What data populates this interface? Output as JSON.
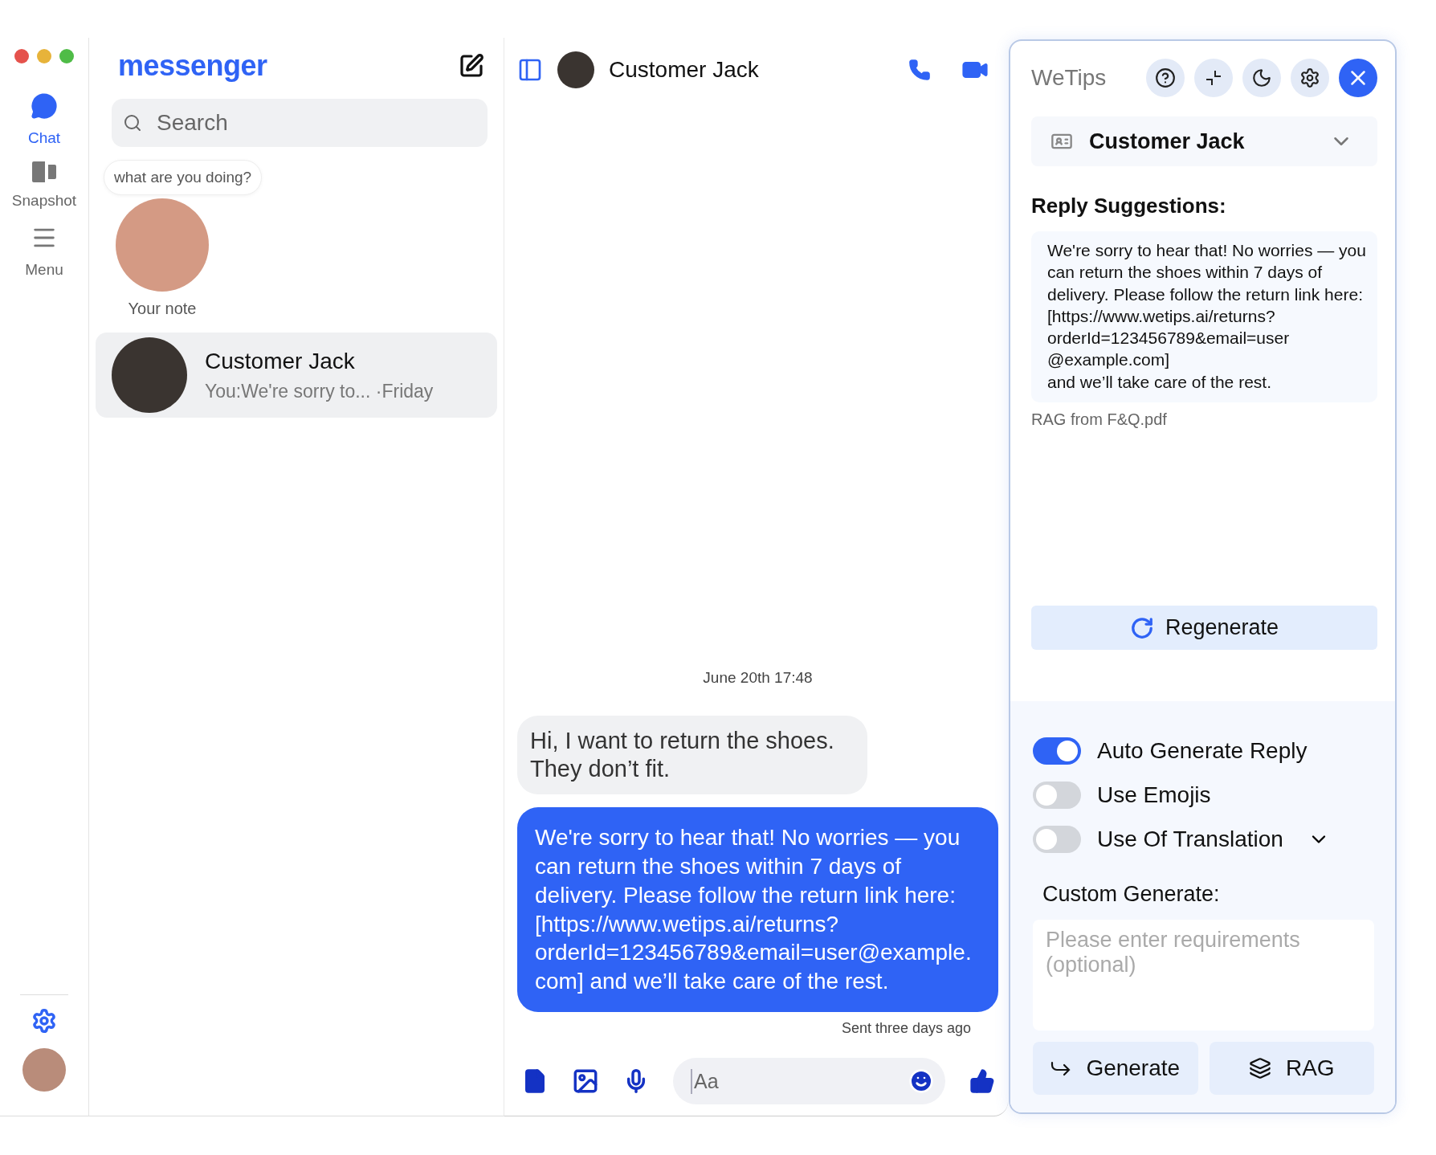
{
  "rail": {
    "items": [
      {
        "kind": "chat",
        "label": "Chat",
        "selected": true
      },
      {
        "kind": "snapshot",
        "label": "Snapshot",
        "selected": false
      },
      {
        "kind": "menu",
        "label": "Menu",
        "selected": false
      }
    ]
  },
  "sidebar": {
    "title": "messenger",
    "search": {
      "placeholder": "Search"
    },
    "note": {
      "text": "what are you doing?",
      "label": "Your note"
    },
    "conversations": [
      {
        "name": "Customer Jack",
        "preview": "You:We're sorry to...",
        "time": "·Friday",
        "selected": true
      }
    ]
  },
  "chat": {
    "contact": "Customer Jack",
    "messages": [
      {
        "kind": "timestamp",
        "text": "June 20th 17:48"
      },
      {
        "kind": "incoming",
        "text": "Hi, I want to return the shoes. They don’t fit."
      },
      {
        "kind": "outgoing",
        "text": "We're sorry to hear that! No worries — you can return the shoes within 7 days of delivery. Please follow the return link here: [https://www.wetips.ai/returns?orderId=123456789&email=user@example.com] and we’ll take care of the rest."
      },
      {
        "kind": "status",
        "text": "Sent three days ago"
      }
    ],
    "composer": {
      "placeholder": "Aa"
    }
  },
  "wetips": {
    "title": "WeTips",
    "contact": "Customer Jack",
    "suggestions_heading": "Reply Suggestions:",
    "suggestion": "We're sorry to hear that! No worries — you can return the shoes within 7 days of delivery. Please follow the return link here: [https://www.wetips.ai/returns?\norderId=123456789&email=user\n@example.com]\nand we’ll take care of the rest.",
    "source": "RAG from F&Q.pdf",
    "regenerate": "Regenerate",
    "toggles": [
      {
        "label": "Auto Generate Reply",
        "on": true,
        "expandable": false
      },
      {
        "label": "Use Emojis",
        "on": false,
        "expandable": false
      },
      {
        "label": "Use Of Translation",
        "on": false,
        "expandable": true
      }
    ],
    "custom_heading": "Custom Generate:",
    "custom_field": {
      "placeholder": "Please enter requirements (optional)"
    },
    "buttons": [
      {
        "kind": "generate",
        "label": "Generate"
      },
      {
        "kind": "rag",
        "label": "RAG"
      }
    ]
  }
}
